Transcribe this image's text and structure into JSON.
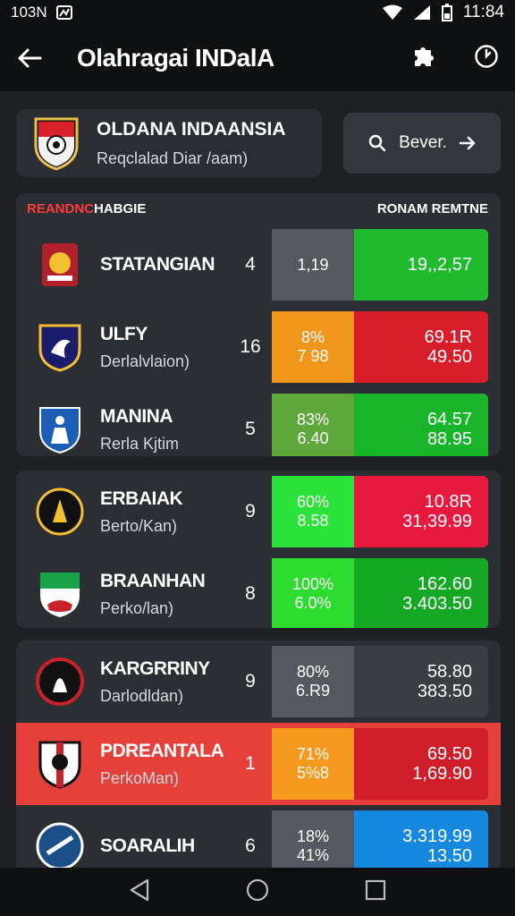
{
  "status_bar": {
    "left_text": "103N",
    "time": "11:84"
  },
  "app_bar": {
    "title": "Olahragai INDalA",
    "back_icon": "arrow-left-icon",
    "actions": [
      "puzzle-icon",
      "clock-icon"
    ]
  },
  "league": {
    "name": "OLDANA INDAANSIA",
    "subtitle": "Reqclalad Diar /aam)"
  },
  "search": {
    "label": "Bever."
  },
  "table_header": {
    "left_red": "REANDNC",
    "left_white": "HABGIE",
    "right": "RONAM REMTNE"
  },
  "groups": [
    {
      "rows": [
        {
          "name": "STATANGIAN",
          "sub": "",
          "num": "4",
          "a1": "1,19",
          "a2": "",
          "b1": "19,,2,57",
          "b2": "",
          "a_color": "#55595f",
          "b_color": "#1fba2e",
          "a_text": "#fff",
          "b_text": "#fff"
        },
        {
          "name": "ULFY",
          "sub": "Derlalvlaion)",
          "num": "16",
          "a1": "8%",
          "a2": "7 98",
          "b1": "69.1R",
          "b2": "49.50",
          "a_color": "#f0961b",
          "b_color": "#d81d2a",
          "a_text": "#fff",
          "b_text": "#fff"
        },
        {
          "name": "MANINA",
          "sub": "Rerla Kjtim",
          "num": "5",
          "a1": "83%",
          "a2": "6.40",
          "b1": "64.57",
          "b2": "88.95",
          "a_color": "#5ea83b",
          "b_color": "#18b52a",
          "a_text": "#fff",
          "b_text": "#fff"
        }
      ]
    },
    {
      "rows": [
        {
          "name": "ERBAIAK",
          "sub": "Berto/Kan)",
          "num": "9",
          "a1": "60%",
          "a2": "8.58",
          "b1": "10.8R",
          "b2": "31,39.99",
          "a_color": "#2be33a",
          "b_color": "#e8193e",
          "a_text": "#fff",
          "b_text": "#fff"
        },
        {
          "name": "BRAANHAN",
          "sub": "Perko/lan)",
          "num": "8",
          "a1": "100%",
          "a2": "6.0%",
          "b1": "162.60",
          "b2": "3.403.50",
          "a_color": "#2ddc2e",
          "b_color": "#14a824",
          "a_text": "#fff",
          "b_text": "#fff"
        }
      ]
    },
    {
      "rows": [
        {
          "name": "KARGRRINY",
          "sub": "Darlodldan)",
          "num": "9",
          "a1": "80%",
          "a2": "6.R9",
          "b1": "58.80",
          "b2": "383.50",
          "a_color": "#55595f",
          "b_color": "#3a3d42",
          "a_text": "#fff",
          "b_text": "#fff",
          "highlight": false
        },
        {
          "name": "PDREANTALA",
          "sub": "PerkoMan)",
          "num": "1",
          "a1": "71%",
          "a2": "5%8",
          "b1": "69.50",
          "b2": "1,69.90",
          "a_color": "#f59a1f",
          "b_color": "#cf1d2a",
          "a_text": "#fff",
          "b_text": "#fff",
          "highlight": true
        },
        {
          "name": "SOARALIH",
          "sub": "",
          "num": "6",
          "a1": "18%",
          "a2": "41%",
          "b1": "3.319.99",
          "b2": "13.50",
          "a_color": "#55595f",
          "b_color": "#1588e0",
          "a_text": "#fff",
          "b_text": "#fff",
          "highlight": false
        }
      ]
    }
  ],
  "nav": [
    "back-triangle-icon",
    "home-circle-icon",
    "recents-square-icon"
  ]
}
